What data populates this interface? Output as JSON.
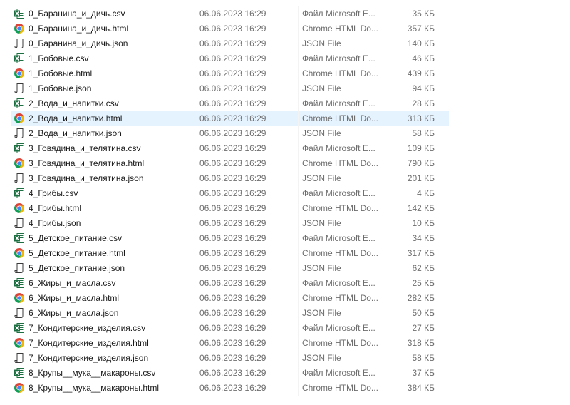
{
  "files": [
    {
      "name": "0_Баранина_и_дичь.csv",
      "date": "06.06.2023 16:29",
      "type": "Файл Microsoft E...",
      "size": "35 КБ",
      "icon": "excel-icon"
    },
    {
      "name": "0_Баранина_и_дичь.html",
      "date": "06.06.2023 16:29",
      "type": "Chrome HTML Do...",
      "size": "357 КБ",
      "icon": "chrome-icon"
    },
    {
      "name": "0_Баранина_и_дичь.json",
      "date": "06.06.2023 16:29",
      "type": "JSON File",
      "size": "140 КБ",
      "icon": "json-file-icon"
    },
    {
      "name": "1_Бобовые.csv",
      "date": "06.06.2023 16:29",
      "type": "Файл Microsoft E...",
      "size": "46 КБ",
      "icon": "excel-icon"
    },
    {
      "name": "1_Бобовые.html",
      "date": "06.06.2023 16:29",
      "type": "Chrome HTML Do...",
      "size": "439 КБ",
      "icon": "chrome-icon"
    },
    {
      "name": "1_Бобовые.json",
      "date": "06.06.2023 16:29",
      "type": "JSON File",
      "size": "94 КБ",
      "icon": "json-file-icon"
    },
    {
      "name": "2_Вода_и_напитки.csv",
      "date": "06.06.2023 16:29",
      "type": "Файл Microsoft E...",
      "size": "28 КБ",
      "icon": "excel-icon"
    },
    {
      "name": "2_Вода_и_напитки.html",
      "date": "06.06.2023 16:29",
      "type": "Chrome HTML Do...",
      "size": "313 КБ",
      "icon": "chrome-icon",
      "selected": true
    },
    {
      "name": "2_Вода_и_напитки.json",
      "date": "06.06.2023 16:29",
      "type": "JSON File",
      "size": "58 КБ",
      "icon": "json-file-icon"
    },
    {
      "name": "3_Говядина_и_телятина.csv",
      "date": "06.06.2023 16:29",
      "type": "Файл Microsoft E...",
      "size": "109 КБ",
      "icon": "excel-icon"
    },
    {
      "name": "3_Говядина_и_телятина.html",
      "date": "06.06.2023 16:29",
      "type": "Chrome HTML Do...",
      "size": "790 КБ",
      "icon": "chrome-icon"
    },
    {
      "name": "3_Говядина_и_телятина.json",
      "date": "06.06.2023 16:29",
      "type": "JSON File",
      "size": "201 КБ",
      "icon": "json-file-icon"
    },
    {
      "name": "4_Грибы.csv",
      "date": "06.06.2023 16:29",
      "type": "Файл Microsoft E...",
      "size": "4 КБ",
      "icon": "excel-icon"
    },
    {
      "name": "4_Грибы.html",
      "date": "06.06.2023 16:29",
      "type": "Chrome HTML Do...",
      "size": "142 КБ",
      "icon": "chrome-icon"
    },
    {
      "name": "4_Грибы.json",
      "date": "06.06.2023 16:29",
      "type": "JSON File",
      "size": "10 КБ",
      "icon": "json-file-icon"
    },
    {
      "name": "5_Детское_питание.csv",
      "date": "06.06.2023 16:29",
      "type": "Файл Microsoft E...",
      "size": "34 КБ",
      "icon": "excel-icon"
    },
    {
      "name": "5_Детское_питание.html",
      "date": "06.06.2023 16:29",
      "type": "Chrome HTML Do...",
      "size": "317 КБ",
      "icon": "chrome-icon"
    },
    {
      "name": "5_Детское_питание.json",
      "date": "06.06.2023 16:29",
      "type": "JSON File",
      "size": "62 КБ",
      "icon": "json-file-icon"
    },
    {
      "name": "6_Жиры_и_масла.csv",
      "date": "06.06.2023 16:29",
      "type": "Файл Microsoft E...",
      "size": "25 КБ",
      "icon": "excel-icon"
    },
    {
      "name": "6_Жиры_и_масла.html",
      "date": "06.06.2023 16:29",
      "type": "Chrome HTML Do...",
      "size": "282 КБ",
      "icon": "chrome-icon"
    },
    {
      "name": "6_Жиры_и_масла.json",
      "date": "06.06.2023 16:29",
      "type": "JSON File",
      "size": "50 КБ",
      "icon": "json-file-icon"
    },
    {
      "name": "7_Кондитерские_изделия.csv",
      "date": "06.06.2023 16:29",
      "type": "Файл Microsoft E...",
      "size": "27 КБ",
      "icon": "excel-icon"
    },
    {
      "name": "7_Кондитерские_изделия.html",
      "date": "06.06.2023 16:29",
      "type": "Chrome HTML Do...",
      "size": "318 КБ",
      "icon": "chrome-icon"
    },
    {
      "name": "7_Кондитерские_изделия.json",
      "date": "06.06.2023 16:29",
      "type": "JSON File",
      "size": "58 КБ",
      "icon": "json-file-icon"
    },
    {
      "name": "8_Крупы__мука__макароны.csv",
      "date": "06.06.2023 16:29",
      "type": "Файл Microsoft E...",
      "size": "37 КБ",
      "icon": "excel-icon"
    },
    {
      "name": "8_Крупы__мука__макароны.html",
      "date": "06.06.2023 16:29",
      "type": "Chrome HTML Do...",
      "size": "384 КБ",
      "icon": "chrome-icon"
    }
  ],
  "colors": {
    "selected_row": "#e5f3ff",
    "excel_green": "#1d6f42",
    "chrome_red": "#db4437",
    "chrome_yellow": "#f4b400",
    "chrome_green": "#0f9d58",
    "chrome_blue": "#4285f4"
  }
}
